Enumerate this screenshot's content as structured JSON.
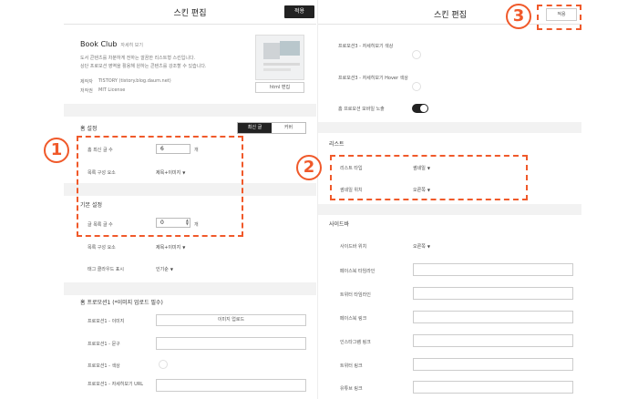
{
  "left": {
    "title": "스킨 편집",
    "save_label": "적용",
    "skin_name": "Book Club",
    "skin_sub": "자세히 보기",
    "desc1": "도서 콘텐츠를 차분하게 전하는 깔끔한 리스트형 스킨입니다.",
    "desc2": "상단 프로모션 영역을 활용해 원하는 콘텐츠를 강조할 수 있습니다.",
    "author_label": "제작자",
    "author_value": "TISTORY (tistory.blog.daum.net)",
    "license_label": "저작권",
    "license_value": "MIT License",
    "html_btn": "html 편집",
    "section_home": "홈 설정",
    "seg_on": "최신 글",
    "seg_off": "커버",
    "list_count_label": "홈 최신 글 수",
    "list_count_value": "6",
    "unit_count": "개",
    "list_element_label": "목록 구성 요소",
    "list_element_value": "제목+이미지",
    "section_basic": "기본 설정",
    "posts_count_label": "글 목록 글 수",
    "posts_count_value": "0",
    "posts_element_label": "목록 구성 요소",
    "posts_element_value": "제목+이미지",
    "tag_cloud_label": "태그 클라우드 표시",
    "tag_cloud_value": "인기순",
    "section_promo": "홈 프로모션1 (*이미지 업로드 필수)",
    "promo_image_label": "프로모션1 - 이미지",
    "upload_label": "이미지 업로드",
    "promo_text_label": "프로모션1 - 문구",
    "promo_color_label": "프로모션1 - 색상",
    "promo_url_label": "프로모션1 - 자세히보기 URL"
  },
  "right": {
    "title": "스킨 편집",
    "done_label": "적용",
    "promo3_color_label": "프로모션3 - 자세히보기 색상",
    "promo3_hover_label": "프로모션3 - 자세히보기 Hover 색상",
    "home_promo_show": "홈 프로모션 모바일 노출",
    "section_list": "리스트",
    "list_type_label": "리스트 타입",
    "list_type_value": "썸네일",
    "thumb_pos_label": "썸네일 위치",
    "thumb_pos_value": "오른쪽",
    "section_sidebar": "사이드바",
    "sidebar_pos_label": "사이드바 위치",
    "sidebar_pos_value": "오른쪽",
    "facebook_timeline": "페이스북 타임라인",
    "twitter_timeline": "트위터 타임라인",
    "facebook_link": "페이스북 링크",
    "instagram_link": "인스타그램 링크",
    "twitter_link": "트위터 링크",
    "youtube_link": "유튜브 링크"
  },
  "annotations": {
    "one": "1",
    "two": "2",
    "three": "3"
  },
  "colors": {
    "annotation": "#f0592a",
    "dark": "#222222"
  }
}
